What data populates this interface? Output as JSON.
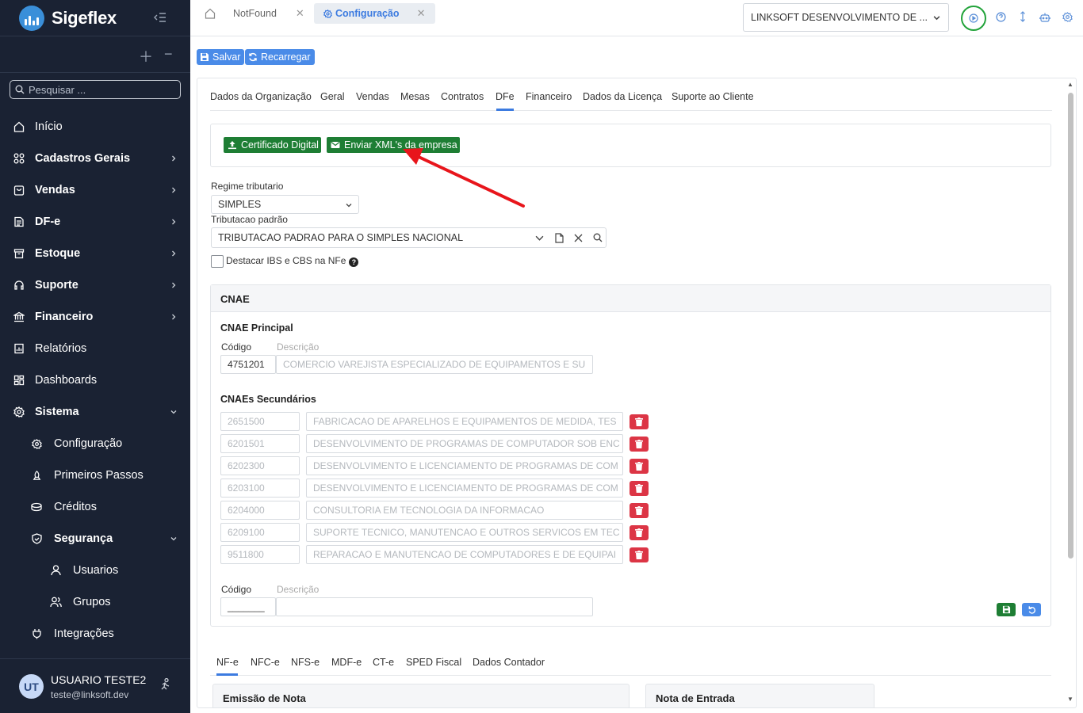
{
  "app": {
    "logo_text": "Sigeflex",
    "search_placeholder": "Pesquisar ..."
  },
  "sidebar": {
    "items": [
      {
        "label": "Início",
        "icon": "home-icon",
        "bold": false,
        "chevron": ""
      },
      {
        "label": "Cadastros Gerais",
        "icon": "grid-icon",
        "bold": true,
        "chevron": "right"
      },
      {
        "label": "Vendas",
        "icon": "shopping-bag-icon",
        "bold": true,
        "chevron": "right"
      },
      {
        "label": "DF-e",
        "icon": "document-icon",
        "bold": true,
        "chevron": "right"
      },
      {
        "label": "Estoque",
        "icon": "archive-icon",
        "bold": true,
        "chevron": "right"
      },
      {
        "label": "Suporte",
        "icon": "headset-icon",
        "bold": true,
        "chevron": "right"
      },
      {
        "label": "Financeiro",
        "icon": "bank-icon",
        "bold": true,
        "chevron": "right"
      },
      {
        "label": "Relatórios",
        "icon": "report-icon",
        "bold": false,
        "chevron": ""
      },
      {
        "label": "Dashboards",
        "icon": "dashboard-icon",
        "bold": false,
        "chevron": ""
      },
      {
        "label": "Sistema",
        "icon": "gear-icon",
        "bold": true,
        "chevron": "down"
      },
      {
        "label": "Configuração",
        "icon": "gear-icon",
        "bold": false,
        "chevron": ""
      },
      {
        "label": "Primeiros Passos",
        "icon": "rocket-icon",
        "bold": false,
        "chevron": ""
      },
      {
        "label": "Créditos",
        "icon": "coins-icon",
        "bold": false,
        "chevron": ""
      },
      {
        "label": "Segurança",
        "icon": "shield-icon",
        "bold": true,
        "chevron": "down"
      },
      {
        "label": "Usuarios",
        "icon": "user-icon",
        "bold": false,
        "chevron": ""
      },
      {
        "label": "Grupos",
        "icon": "users-icon",
        "bold": false,
        "chevron": ""
      },
      {
        "label": "Integrações",
        "icon": "plug-icon",
        "bold": false,
        "chevron": ""
      }
    ],
    "user": {
      "initials": "UT",
      "name": "USUARIO TESTE2",
      "email": "teste@linksoft.dev"
    }
  },
  "topbar": {
    "tabs": [
      {
        "label": "NotFound",
        "active": false
      },
      {
        "label": "Configuração",
        "active": true
      }
    ],
    "company": "LINKSOFT DESENVOLVIMENTO DE ..."
  },
  "actions": {
    "save": "Salvar",
    "reload": "Recarregar"
  },
  "config_tabs": [
    "Dados da Organização",
    "Geral",
    "Vendas",
    "Mesas",
    "Contratos",
    "DFe",
    "Financeiro",
    "Dados da Licença",
    "Suporte ao Cliente"
  ],
  "config_active_tab": "DFe",
  "dfe": {
    "cert_button": "Certificado Digital",
    "send_xml_button": "Enviar XML's da empresa",
    "regime_label": "Regime tributario",
    "regime_value": "SIMPLES",
    "tributacao_label": "Tributacao padrão",
    "tributacao_value": "TRIBUTACAO PADRAO PARA O SIMPLES NACIONAL",
    "destacar_label": "Destacar IBS e CBS na NFe",
    "destacar_checked": false,
    "help_glyph": "?"
  },
  "cnae": {
    "title": "CNAE",
    "principal_title": "CNAE Principal",
    "codigo_label": "Código",
    "descricao_label": "Descrição",
    "principal_code": "4751201",
    "principal_desc": "COMERCIO VAREJISTA ESPECIALIZADO DE EQUIPAMENTOS E SU",
    "secundarios_title": "CNAEs Secundários",
    "secundarios": [
      {
        "code": "2651500",
        "desc": "FABRICACAO DE APARELHOS E EQUIPAMENTOS DE MEDIDA, TES"
      },
      {
        "code": "6201501",
        "desc": "DESENVOLVIMENTO DE PROGRAMAS DE COMPUTADOR SOB ENC"
      },
      {
        "code": "6202300",
        "desc": "DESENVOLVIMENTO E LICENCIAMENTO DE PROGRAMAS DE COM"
      },
      {
        "code": "6203100",
        "desc": "DESENVOLVIMENTO E LICENCIAMENTO DE PROGRAMAS DE COM"
      },
      {
        "code": "6204000",
        "desc": "CONSULTORIA EM TECNOLOGIA DA INFORMACAO"
      },
      {
        "code": "6209100",
        "desc": "SUPORTE TECNICO, MANUTENCAO E OUTROS SERVICOS EM TEC"
      },
      {
        "code": "9511800",
        "desc": "REPARACAO E MANUTENCAO DE COMPUTADORES E DE EQUIPAI"
      }
    ],
    "new_codigo_label": "Código",
    "new_descricao_label": "Descrição",
    "new_code_mask": "_______",
    "new_desc_value": ""
  },
  "doc_tabs": [
    "NF-e",
    "NFC-e",
    "NFS-e",
    "MDF-e",
    "CT-e",
    "SPED Fiscal",
    "Dados Contador"
  ],
  "doc_active_tab": "NF-e",
  "cards": {
    "emissao": "Emissão de Nota",
    "entrada": "Nota de Entrada"
  },
  "colors": {
    "sidebar_bg": "#1a2233",
    "accent_blue": "#4a8be8",
    "green": "#1e7e34",
    "danger": "#dc3545",
    "arrow": "#e8151b"
  }
}
